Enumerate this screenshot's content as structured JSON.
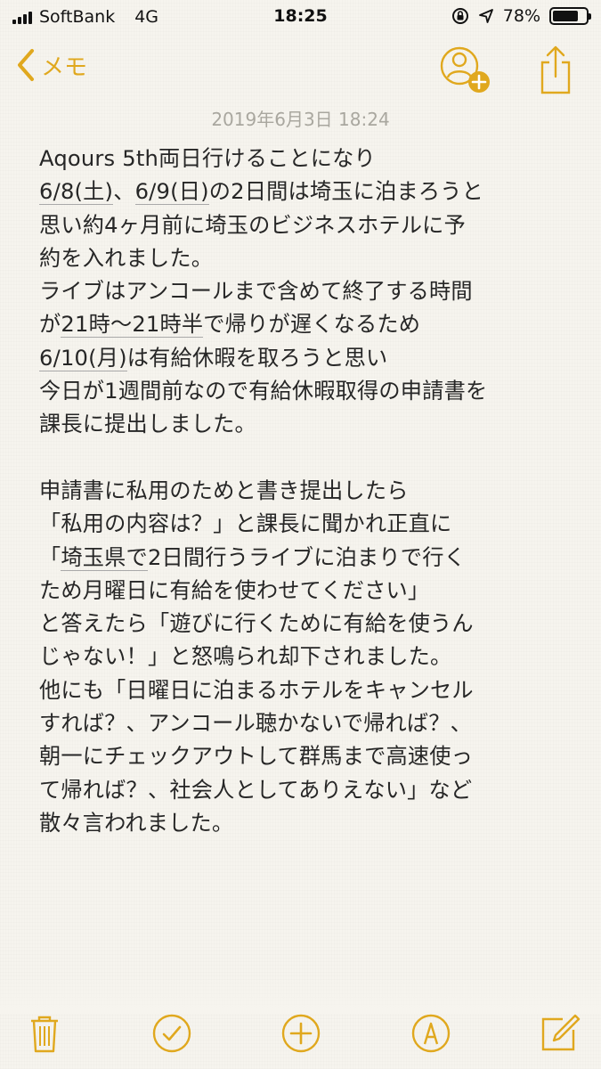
{
  "status_bar": {
    "carrier": "SoftBank",
    "network": "4G",
    "time": "18:25",
    "battery_percent": "78%",
    "battery_level": 0.78
  },
  "nav": {
    "back_label": "メモ",
    "share_icon": "share-icon",
    "add_person_icon": "add-person-icon"
  },
  "note": {
    "date": "2019年6月3日 18:24",
    "lines": [
      "Aqours 5th両日行けることになり",
      "6/8(土)、6/9(日)の2日間は埼玉に泊まろうと",
      "思い約4ヶ月前に埼玉のビジネスホテルに予",
      "約を入れました。",
      "ライブはアンコールまで含めて終了する時間",
      "が21時〜21時半で帰りが遅くなるため",
      "6/10(月)は有給休暇を取ろうと思い",
      "今日が1週間前なので有給休暇取得の申請書を",
      "課長に提出しました。",
      "",
      "申請書に私用のためと書き提出したら",
      "「私用の内容は？」と課長に聞かれ正直に",
      "「埼玉県で2日間行うライブに泊まりで行く",
      "ため月曜日に有給を使わせてください」",
      "と答えたら「遊びに行くために有給を使うん",
      "じゃない！」と怒鳴られ却下されました。",
      "他にも「日曜日に泊まるホテルをキャンセル",
      "すれば？、アンコール聴かないで帰れば？、",
      "朝一にチェックアウトして群馬まで高速使っ",
      "て帰れば？、社会人としてありえない」など",
      "散々言われました。"
    ]
  },
  "colors": {
    "accent": "#e0a81e",
    "background": "#f6f4ee",
    "text": "#262626",
    "date": "#a9a79f"
  },
  "toolbar": {
    "icons": [
      "trash-icon",
      "checklist-icon",
      "add-icon",
      "markup-icon",
      "compose-icon"
    ]
  }
}
